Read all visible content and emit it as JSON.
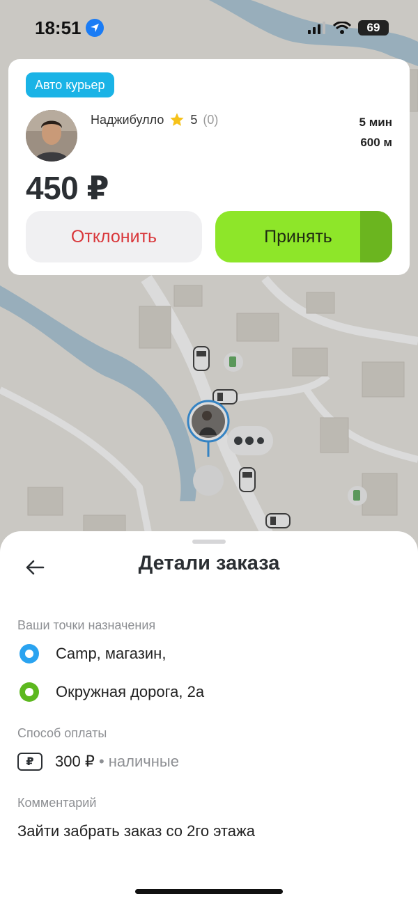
{
  "status_bar": {
    "time": "18:51",
    "battery": "69"
  },
  "order_card": {
    "badge": "Авто курьер",
    "courier_name": "Наджибулло",
    "rating": "5",
    "rating_count": "(0)",
    "eta_time": "5 мин",
    "eta_distance": "600 м",
    "price": "450 ₽",
    "decline_label": "Отклонить",
    "accept_label": "Принять",
    "accept_progress": 0.18
  },
  "sheet": {
    "title": "Детали заказа",
    "destinations_label": "Ваши точки назначения",
    "destinations": [
      "Camp, магазин,",
      "Окружная дорога, 2а"
    ],
    "payment_label": "Способ оплаты",
    "payment_amount": "300 ₽",
    "payment_separator": "•",
    "payment_method": "наличные",
    "payment_icon_glyph": "₽",
    "comment_label": "Комментарий",
    "comment": "Зайти забрать заказ со 2го этажа"
  },
  "colors": {
    "accent_blue": "#1ab3e6",
    "accept_green": "#8ee629",
    "accept_green_dark": "#6bb51f",
    "decline_red": "#d9373b"
  }
}
